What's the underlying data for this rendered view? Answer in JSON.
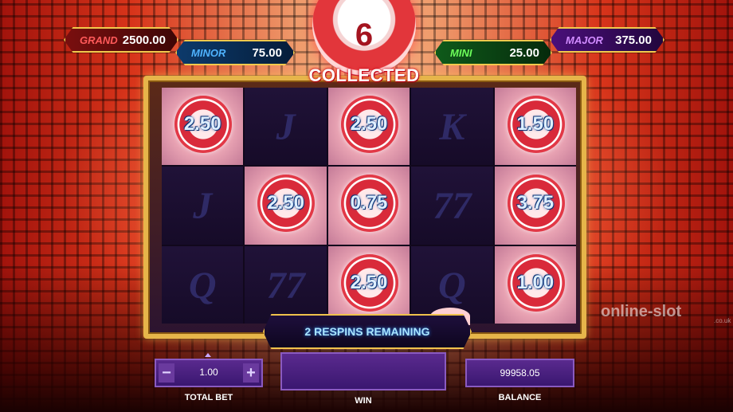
{
  "jackpots": {
    "grand": {
      "label": "GRAND",
      "value": "2500.00"
    },
    "minor": {
      "label": "MINOR",
      "value": "75.00"
    },
    "mini": {
      "label": "MINI",
      "value": "25.00"
    },
    "major": {
      "label": "MAJOR",
      "value": "375.00"
    }
  },
  "collected": {
    "count": "6",
    "label": "COLLECTED"
  },
  "reels": [
    [
      {
        "type": "coin",
        "value": "2.50"
      },
      {
        "type": "symbol",
        "value": "J"
      },
      {
        "type": "coin",
        "value": "2.50"
      },
      {
        "type": "symbol",
        "value": "K"
      },
      {
        "type": "coin",
        "value": "1.50"
      }
    ],
    [
      {
        "type": "symbol",
        "value": "J"
      },
      {
        "type": "coin",
        "value": "2.50"
      },
      {
        "type": "coin",
        "value": "0.75"
      },
      {
        "type": "symbol",
        "value": "77"
      },
      {
        "type": "coin",
        "value": "3.75"
      }
    ],
    [
      {
        "type": "symbol",
        "value": "Q"
      },
      {
        "type": "symbol",
        "value": "77"
      },
      {
        "type": "coin",
        "value": "2.50"
      },
      {
        "type": "symbol",
        "value": "Q"
      },
      {
        "type": "coin",
        "value": "1.00"
      }
    ]
  ],
  "respins": {
    "text": "2 RESPINS REMAINING"
  },
  "bottom": {
    "total_bet": {
      "label": "TOTAL BET",
      "value": "1.00",
      "minus": "−",
      "plus": "+"
    },
    "win": {
      "label": "WIN",
      "value": ""
    },
    "balance": {
      "label": "BALANCE",
      "value": "99958.05"
    }
  },
  "watermark": {
    "text": "online-slot",
    "sub": ".co.uk"
  }
}
